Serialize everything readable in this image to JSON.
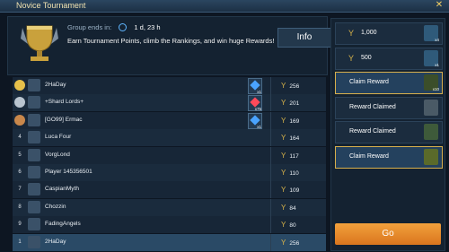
{
  "title": "Novice Tournament",
  "close_icon": "close-icon",
  "header": {
    "group_ends_label": "Group ends in:",
    "time_left": "1 d, 23 h",
    "description": "Earn Tournament Points, climb the Rankings, and win huge Rewards!",
    "info_label": "Info"
  },
  "rows": [
    {
      "rank": "",
      "name": "2HaDay",
      "points": "256",
      "reward_qty": "x1",
      "reward_color": "#4aa3ff"
    },
    {
      "rank": "",
      "name": "+Shard Lords+",
      "points": "201",
      "reward_qty": "x75",
      "reward_color": "#ff4a5a"
    },
    {
      "rank": "",
      "name": "[GO99] Ermac",
      "points": "169",
      "reward_qty": "x1",
      "reward_color": "#4aa3ff"
    },
    {
      "rank": "4",
      "name": "Luca Four",
      "points": "164"
    },
    {
      "rank": "5",
      "name": "VorgLond",
      "points": "117"
    },
    {
      "rank": "6",
      "name": "Player 145356501",
      "points": "110"
    },
    {
      "rank": "7",
      "name": "CaspianMyth",
      "points": "109"
    },
    {
      "rank": "8",
      "name": "Chozzin",
      "points": "84"
    },
    {
      "rank": "9",
      "name": "FadingAngels",
      "points": "80"
    },
    {
      "rank": "1",
      "name": "2HaDay",
      "points": "256"
    }
  ],
  "tiers": [
    {
      "value": "1,000",
      "qty": "x4"
    },
    {
      "value": "500",
      "qty": "x1"
    },
    {
      "label": "Claim Reward",
      "qty": "x10"
    },
    {
      "label": "Reward Claimed",
      "qty": ""
    },
    {
      "label": "Reward Claimed",
      "qty": ""
    },
    {
      "label": "Claim Reward",
      "qty": ""
    }
  ],
  "go_label": "Go"
}
